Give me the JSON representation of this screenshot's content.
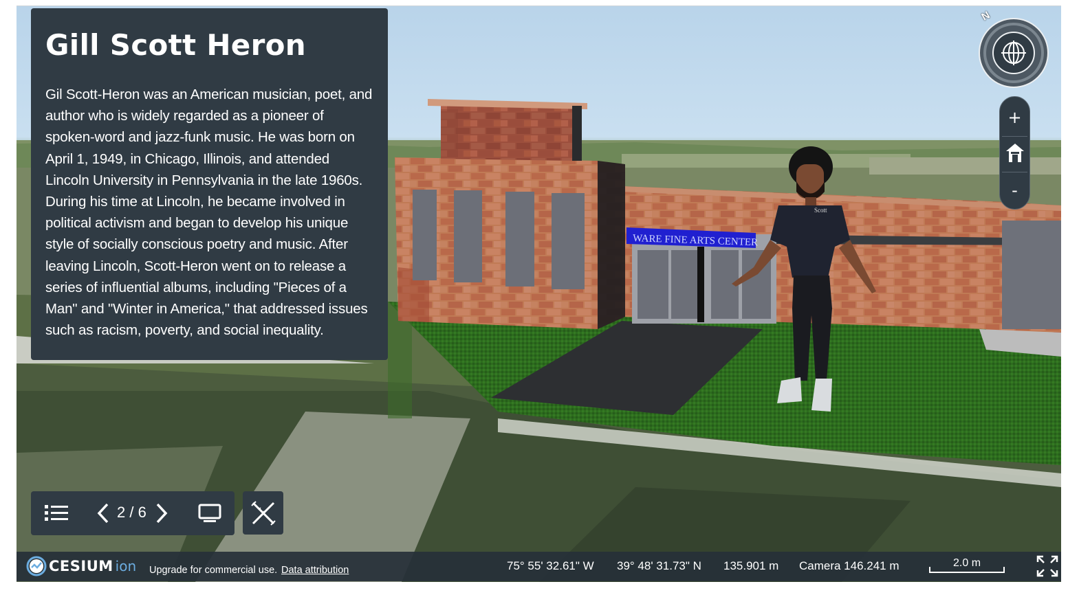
{
  "info_panel": {
    "title": "Gill Scott Heron",
    "body": "Gil Scott-Heron was an American musician, poet, and author who is widely regarded as a pioneer of spoken-word and jazz-funk music. He was born on April 1, 1949, in Chicago, Illinois, and attended Lincoln University in Pennsylvania in the late 1960s. During his time at Lincoln, he became involved in political activism and began to develop his unique style of socially conscious poetry and music. After leaving Lincoln, Scott-Heron went on to release a series of influential albums, including \"Pieces of a Man\" and \"Winter in America,\" that addressed issues such as racism, poverty, and social inequality."
  },
  "scene": {
    "building_sign": "WARE FINE ARTS CENTER",
    "shirt_text": "Scott"
  },
  "tour_controls": {
    "counter": "2 / 6",
    "list_icon": "list-icon",
    "prev_icon": "chevron-left-icon",
    "next_icon": "chevron-right-icon",
    "screen_icon": "monitor-icon",
    "measure_icon": "ruler-pencil-icon"
  },
  "navigation": {
    "compass_label": "N",
    "zoom_in": "+",
    "home_icon": "home-icon",
    "zoom_out": "-"
  },
  "status_bar": {
    "brand": "CESIUM",
    "brand_suffix": "ion",
    "upgrade_text": "Upgrade for commercial use.",
    "attribution_link": "Data attribution",
    "longitude": "75° 55' 32.61\" W",
    "latitude": "39° 48' 31.73\" N",
    "elevation": "135.901 m",
    "camera": "Camera 146.241 m",
    "scale": "2.0 m",
    "fullscreen_icon": "fullscreen-icon"
  },
  "colors": {
    "panel": "#303b44",
    "brick": "#b8704f",
    "grass": "#2f6e1f",
    "sign": "#2020d0",
    "ion_blue": "#6cade0"
  }
}
